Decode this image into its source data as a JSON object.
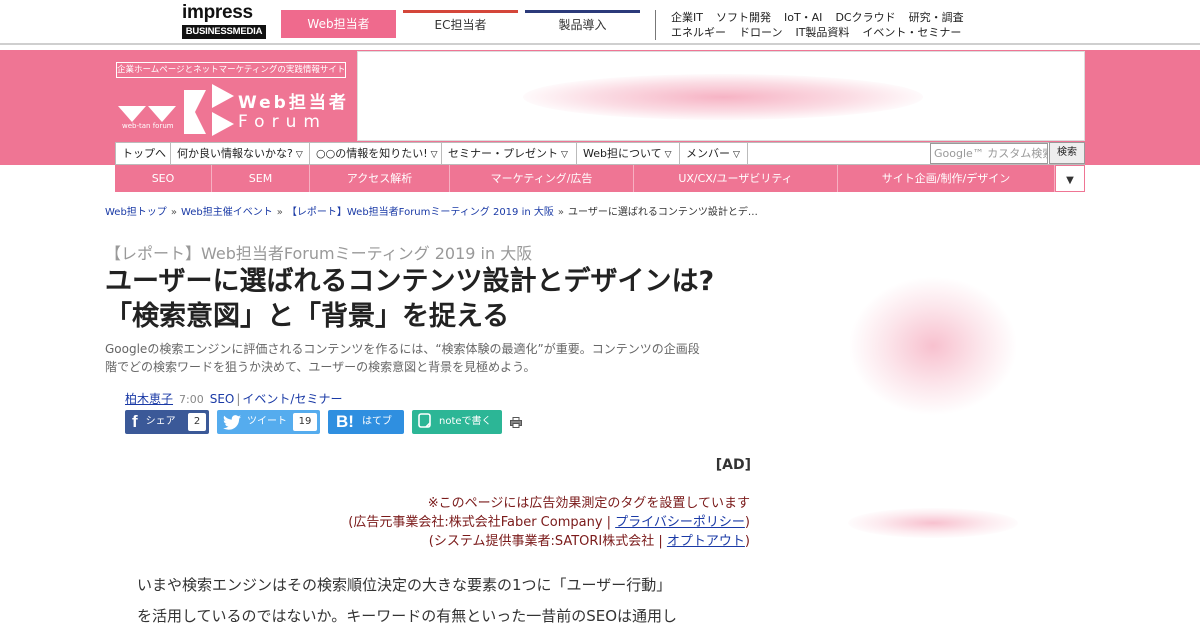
{
  "topbar": {
    "logo_word": "impress",
    "logo_sub": "BUSINESSMEDIA",
    "services": [
      "Web担当者",
      "EC担当者",
      "製品導入"
    ],
    "links_row1": [
      "企業IT",
      "ソフト開発",
      "IoT・AI",
      "DCクラウド",
      "研究・調査"
    ],
    "links_row2": [
      "エネルギー",
      "ドローン",
      "IT製品資料",
      "イベント・セミナー"
    ]
  },
  "masthead": {
    "tagline": "企業ホームページとネットマーケティングの実践情報サイト",
    "logo_name": "Web担当者",
    "logo_sub": "Forum",
    "logo_small": "web-tan forum"
  },
  "nav1": [
    "トップへ",
    "何か良い情報ないかな?",
    "○○の情報を知りたい!",
    "セミナー・プレゼント",
    "Web担について",
    "メンバー"
  ],
  "search": {
    "placeholder": "Google™ カスタム検索",
    "button": "検索"
  },
  "nav2": [
    "SEO",
    "SEM",
    "アクセス解析",
    "マーケティング/広告",
    "UX/CX/ユーザビリティ",
    "サイト企画/制作/デザイン"
  ],
  "nav2_more": "▼",
  "breadcrumb": [
    "Web担トップ",
    "Web担主催イベント",
    "【レポート】Web担当者Forumミーティング 2019 in 大阪",
    "ユーザーに選ばれるコンテンツ設計とデ…"
  ],
  "breadcrumb_sep": "»",
  "article": {
    "kicker": "【レポート】Web担当者Forumミーティング 2019 in 大阪",
    "headline_line1": "ユーザーに選ばれるコンテンツ設計とデザインは?",
    "headline_line2": "「検索意図」と「背景」を捉える",
    "lead_line1": "Googleの検索エンジンに評価されるコンテンツを作るには、“検索体験の最適化”が重要。コンテンツの企画段",
    "lead_line2": "階でどの検索ワードを狙うか決めて、ユーザーの検索意図と背景を見極めよう。",
    "author": "柏木恵子",
    "time": "7:00",
    "category1": "SEO",
    "category_sep": "|",
    "category2": "イベント/セミナー"
  },
  "share": {
    "facebook_label": "シェア",
    "facebook_count": "2",
    "twitter_label": "ツイート",
    "twitter_count": "19",
    "hatena_label": "はてブ",
    "note_label": "noteで書く"
  },
  "ad": {
    "mark": "[AD]",
    "line1": "※このページには広告効果測定のタグを設置しています",
    "line2_pre": "(広告元事業会社:株式会社Faber Company | ",
    "line2_link": "プライバシーポリシー",
    "line2_post": ")",
    "line3_pre": "(システム提供事業者:SATORI株式会社 | ",
    "line3_link": "オプトアウト",
    "line3_post": ")"
  },
  "body": {
    "line1": "いまや検索エンジンはその検索順位決定の大きな要素の1つに「ユーザー行動」",
    "line2": "を活用しているのではないか。キーワードの有無といった一昔前のSEOは通用し"
  },
  "colors": {
    "brand_pink": "#ef7594",
    "link_blue": "#1a3aa6",
    "facebook": "#3b5998",
    "twitter": "#55acee",
    "hatena": "#2f8fe0",
    "note": "#2cb696"
  }
}
